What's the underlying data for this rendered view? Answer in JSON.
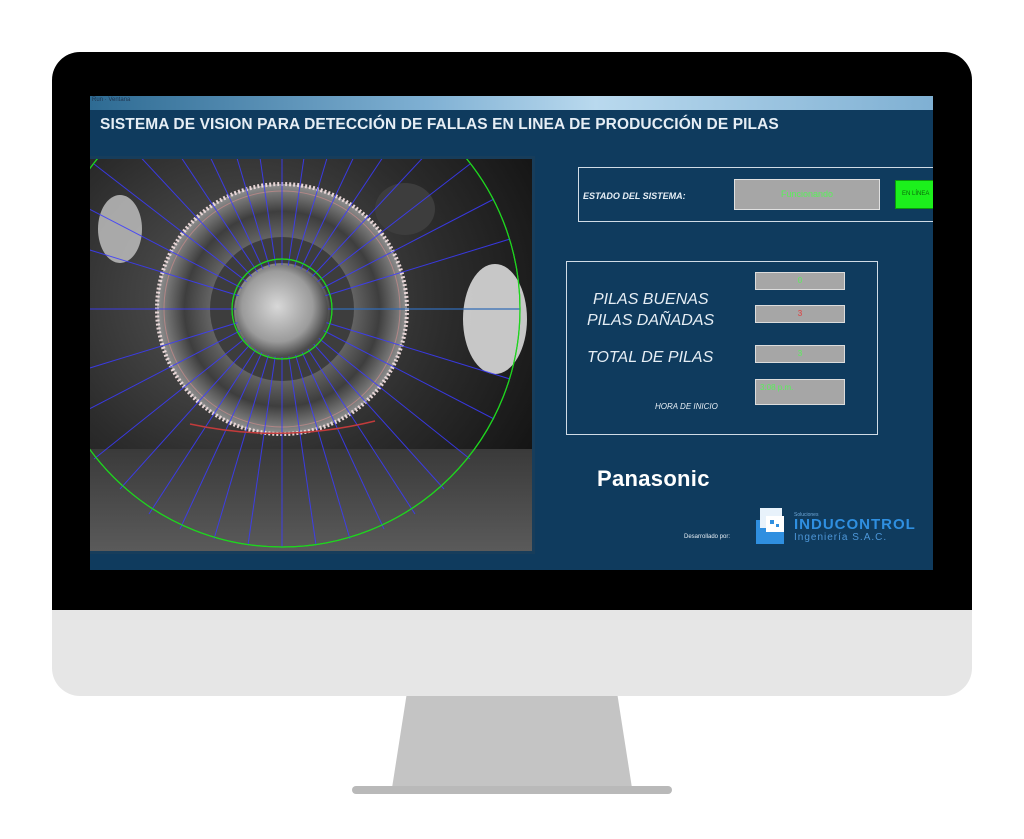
{
  "window": {
    "caption": "Run · Ventana"
  },
  "app": {
    "title": "SISTEMA DE VISION  PARA DETECCIÓN DE FALLAS EN LINEA DE PRODUCCIÓN DE PILAS"
  },
  "status": {
    "label": "ESTADO DEL SISTEMA:",
    "value": "Funcionando",
    "indicator": "EN LÍNEA",
    "indicator_color": "#1cf01c"
  },
  "counters": {
    "good_label": "PILAS BUENAS",
    "good_value": "0",
    "damaged_label": "PILAS DAÑADAS",
    "damaged_value": "3",
    "total_label": "TOTAL DE PILAS",
    "total_value": "3",
    "start_label": "HORA DE INICIO",
    "start_value": "3:08 p.m."
  },
  "branding": {
    "panasonic": "Panasonic",
    "developed_by": "Desarrollado por:",
    "company_small": "Soluciones",
    "company_name": "INDUCONTROL",
    "company_sub": "Ingeniería  S.A.C."
  },
  "colors": {
    "screen_bg": "#0f3b5e",
    "good_text": "#5af05a",
    "damaged_text": "#e23b3b",
    "overlay_lines": "#3b3bff",
    "overlay_circles": "#1fd41f"
  }
}
